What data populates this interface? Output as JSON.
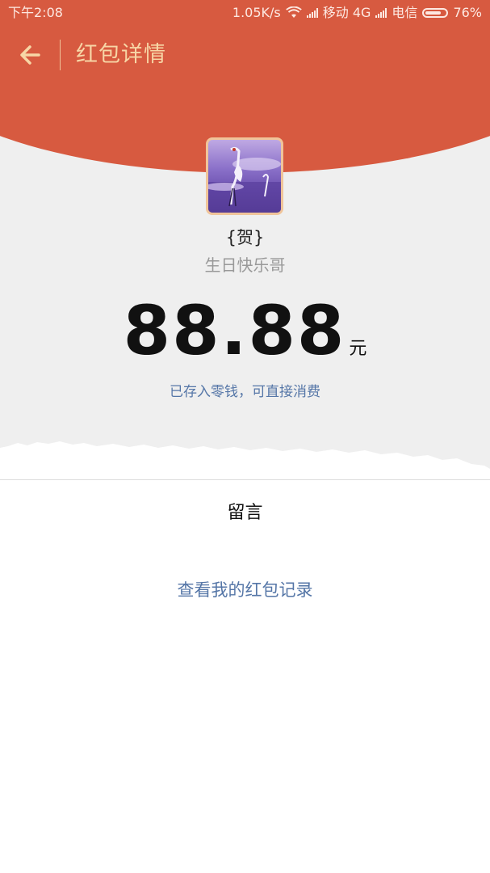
{
  "status_bar": {
    "time": "下午2:08",
    "speed": "1.05K/s",
    "carrier1": "移动 4G",
    "carrier2": "电信",
    "battery": "76%"
  },
  "nav": {
    "title": "红包详情",
    "back_icon": "arrow-left-icon"
  },
  "sender": {
    "name": "{贺}",
    "wish": "生日快乐哥"
  },
  "amount": {
    "value": "88.88",
    "unit": "元",
    "note": "已存入零钱，可直接消费"
  },
  "message": {
    "label": "留言"
  },
  "records_link": "查看我的红包记录",
  "colors": {
    "header_red": "#d75a40",
    "title_gold": "#f7d6a6",
    "link_blue": "#5576a7",
    "background_gray": "#efefef"
  }
}
